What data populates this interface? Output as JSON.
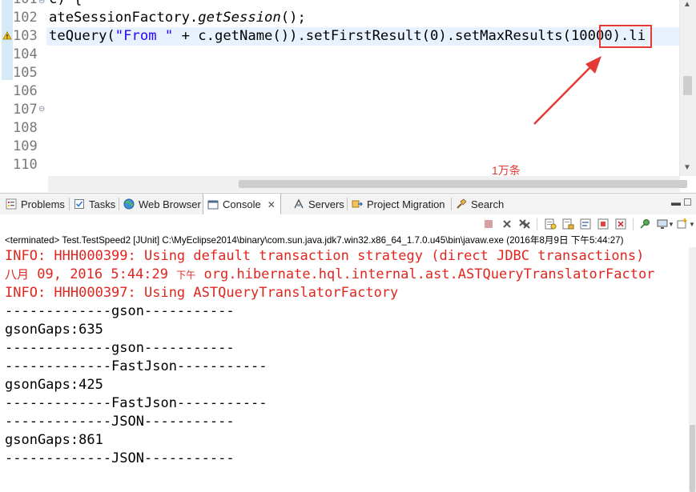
{
  "editor": {
    "lines": [
      {
        "num": "101",
        "text": "c) {"
      },
      {
        "num": "102",
        "text_pre": "ateSessionFactory.",
        "text_italic": "getSession",
        "text_post": "();"
      },
      {
        "num": "103",
        "pre": "teQuery(",
        "str": "\"From \"",
        "mid": " + c.getName()).setFirstResult(0).setMaxResults(",
        "num_value": "10000",
        "post": ").li"
      },
      {
        "num": "104",
        "text": ""
      },
      {
        "num": "105",
        "text": ""
      },
      {
        "num": "106",
        "text": ""
      },
      {
        "num": "107",
        "text": ""
      },
      {
        "num": "108",
        "text": ""
      },
      {
        "num": "109",
        "text": ""
      },
      {
        "num": "110",
        "text": ""
      }
    ],
    "annotation": "1万条",
    "highlight_color": "#e53935"
  },
  "tabs": [
    {
      "label": "Problems",
      "icon": "problems-icon"
    },
    {
      "label": "Tasks",
      "icon": "tasks-icon"
    },
    {
      "label": "Web Browser",
      "icon": "globe-icon"
    },
    {
      "label": "Console",
      "icon": "console-icon",
      "active": true
    },
    {
      "label": "Servers",
      "icon": "servers-icon"
    },
    {
      "label": "Project Migration",
      "icon": "migration-icon"
    },
    {
      "label": "Search",
      "icon": "search-icon"
    }
  ],
  "console": {
    "terminated": "<terminated> Test.TestSpeed2 [JUnit] C:\\MyEclipse2014\\binary\\com.sun.java.jdk7.win32.x86_64_1.7.0.u45\\bin\\javaw.exe (2016年8月9日 下午5:44:27)",
    "lines": [
      {
        "text": "INFO: HHH000399: Using default transaction strategy (direct JDBC transactions)",
        "style": "err"
      },
      {
        "cn_month": "八月",
        "text_a": " 09, 2016 5:44:29 ",
        "cn_ampm": "下午",
        "text_b": " org.hibernate.hql.internal.ast.ASTQueryTranslatorFactor",
        "style": "err"
      },
      {
        "text": "INFO: HHH000397: Using ASTQueryTranslatorFactory",
        "style": "err"
      },
      {
        "text": "-------------gson-----------",
        "style": "out"
      },
      {
        "text": "gsonGaps:635",
        "style": "out"
      },
      {
        "text": "-------------gson-----------",
        "style": "out"
      },
      {
        "text": "-------------FastJson-----------",
        "style": "out"
      },
      {
        "text": "gsonGaps:425",
        "style": "out"
      },
      {
        "text": "-------------FastJson-----------",
        "style": "out"
      },
      {
        "text": "-------------JSON-----------",
        "style": "out"
      },
      {
        "text": "gsonGaps:861",
        "style": "out"
      },
      {
        "text": "-------------JSON-----------",
        "style": "out"
      }
    ],
    "error_color": "#e0261f"
  }
}
